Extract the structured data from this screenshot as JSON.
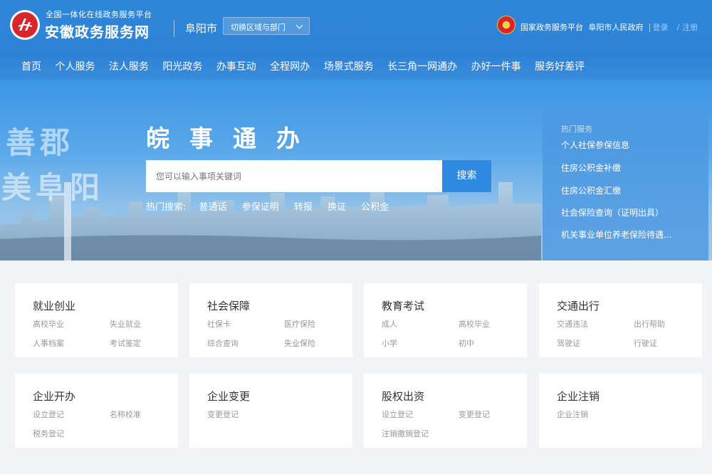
{
  "header": {
    "brand_subtitle": "全国一体化在线政务服务平台",
    "brand_title": "安徽政务服务网",
    "city": "阜阳市",
    "region_switch": "切换区域与部门",
    "national_platform": "国家政务服务平台",
    "city_government": "阜阳市人民政府",
    "login": "登录",
    "register": "注册",
    "logo_icon": "anhui-gov-logo-icon",
    "emblem_icon": "national-emblem-icon",
    "colors": {
      "header_bg": "#2f86d9",
      "login_link": "#9fd0ff",
      "logo_red": "#d9262c"
    }
  },
  "nav": {
    "items": [
      "首页",
      "个人服务",
      "法人服务",
      "阳光政务",
      "办事互动",
      "全程网办",
      "场景式服务",
      "长三角一网通办",
      "办好一件事",
      "服务好差评"
    ]
  },
  "banner": {
    "calligraphy_line1": "善郡",
    "calligraphy_line2": "美阜阳",
    "slogan": "皖事通办",
    "search_placeholder": "您可以输入事项关键词",
    "search_button": "搜索",
    "hot_search_label": "热门搜索:",
    "hot_search": [
      "普通话",
      "参保证明",
      "转报",
      "换证",
      "公积金"
    ]
  },
  "hot_services": {
    "title": "热门服务",
    "items": [
      "个人社保参保信息",
      "住房公积金补缴",
      "住房公积金汇缴",
      "社会保险查询（证明出具）",
      "机关事业单位养老保险待遇..."
    ]
  },
  "cards": [
    {
      "title": "就业创业",
      "links": [
        "高校毕业",
        "失业就业",
        "人事档案",
        "考试鉴定"
      ]
    },
    {
      "title": "社会保障",
      "links": [
        "社保卡",
        "医疗保险",
        "综合查询",
        "失业保险"
      ]
    },
    {
      "title": "教育考试",
      "links": [
        "成人",
        "高校毕业",
        "小学",
        "初中"
      ]
    },
    {
      "title": "交通出行",
      "links": [
        "交通违法",
        "出行帮助",
        "驾驶证",
        "行驶证"
      ]
    },
    {
      "title": "企业开办",
      "links": [
        "设立登记",
        "名称校准",
        "税务登记"
      ]
    },
    {
      "title": "企业变更",
      "links": [
        "变更登记"
      ]
    },
    {
      "title": "股权出资",
      "links": [
        "设立登记",
        "变更登记",
        "注销撤销登记"
      ]
    },
    {
      "title": "企业注销",
      "links": [
        "企业注销"
      ]
    }
  ]
}
